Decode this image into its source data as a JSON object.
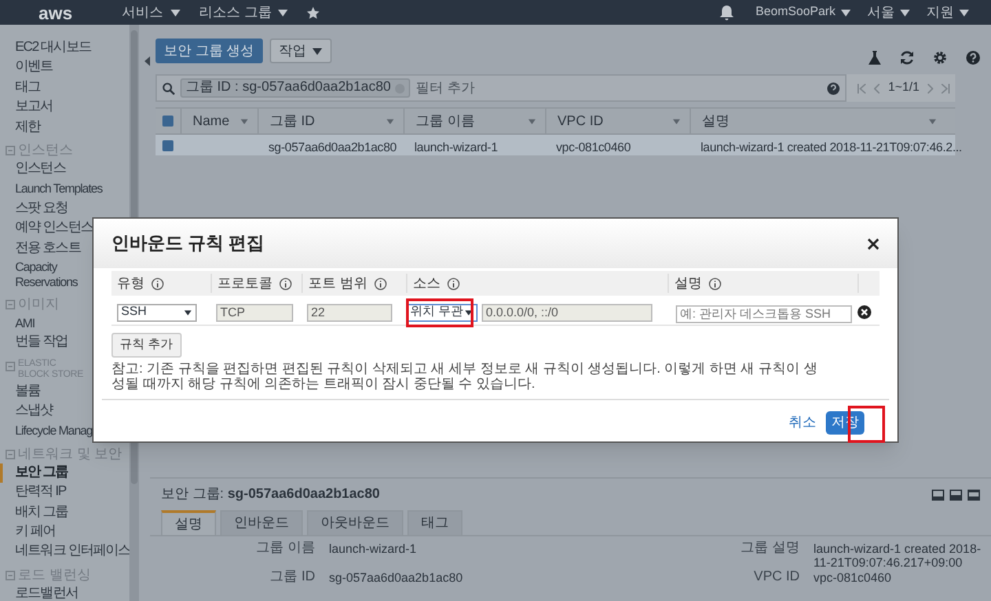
{
  "nav": {
    "logo": "aws",
    "menus": [
      "서비스",
      "리소스 그룹"
    ],
    "user": "BeomSooPark",
    "region": "서울",
    "support": "지원"
  },
  "sidebar": {
    "items": [
      {
        "kind": "item",
        "label": "EC2 대시보드",
        "selected": false
      },
      {
        "kind": "item",
        "label": "이벤트",
        "selected": false
      },
      {
        "kind": "item",
        "label": "태그",
        "selected": false
      },
      {
        "kind": "item",
        "label": "보고서",
        "selected": false
      },
      {
        "kind": "item",
        "label": "제한",
        "selected": false
      },
      {
        "kind": "header",
        "label": "인스턴스"
      },
      {
        "kind": "item",
        "label": "인스턴스",
        "selected": false
      },
      {
        "kind": "item",
        "label": "Launch Templates",
        "selected": false
      },
      {
        "kind": "item",
        "label": "스팟 요청",
        "selected": false
      },
      {
        "kind": "item",
        "label": "예약 인스턴스",
        "selected": false
      },
      {
        "kind": "item",
        "label": "전용 호스트",
        "selected": false
      },
      {
        "kind": "item",
        "label": "Capacity Reservations",
        "selected": false
      },
      {
        "kind": "header",
        "label": "이미지"
      },
      {
        "kind": "item",
        "label": "AMI",
        "selected": false
      },
      {
        "kind": "item",
        "label": "번들 작업",
        "selected": false
      },
      {
        "kind": "header",
        "label": "ELASTIC BLOCK STORE"
      },
      {
        "kind": "item",
        "label": "볼륨",
        "selected": false
      },
      {
        "kind": "item",
        "label": "스냅샷",
        "selected": false
      },
      {
        "kind": "item",
        "label": "Lifecycle Manag",
        "selected": false
      },
      {
        "kind": "header",
        "label": "네트워크 및 보안"
      },
      {
        "kind": "item",
        "label": "보안 그룹",
        "selected": true
      },
      {
        "kind": "item",
        "label": "탄력적 IP",
        "selected": false
      },
      {
        "kind": "item",
        "label": "배치 그룹",
        "selected": false
      },
      {
        "kind": "item",
        "label": "키 페어",
        "selected": false
      },
      {
        "kind": "item",
        "label": "네트워크 인터페이스",
        "selected": false
      },
      {
        "kind": "header",
        "label": "로드 밸런싱"
      },
      {
        "kind": "item",
        "label": "로드밸런서",
        "selected": false
      }
    ]
  },
  "toolbar": {
    "create_button": "보안 그룹 생성",
    "actions_button": "작업"
  },
  "filter": {
    "chip": "그룹 ID : sg-057aa6d0aa2b1ac80",
    "placeholder": "필터 추가",
    "pagination": "1~1/1"
  },
  "table": {
    "all_selected": true,
    "columns": [
      "Name",
      "그룹 ID",
      "그룹 이름",
      "VPC ID",
      "설명"
    ],
    "rows": [
      {
        "selected": true,
        "group_id": "sg-057aa6d0aa2b1ac80",
        "group_name": "launch-wizard-1",
        "vpc_id": "vpc-081c0460",
        "description": "launch-wizard-1 created 2018-11-21T09:07:46.2..."
      }
    ]
  },
  "modal": {
    "title": "인바운드 규칙 편집",
    "columns": [
      "유형",
      "프로토콜",
      "포트 범위",
      "소스",
      "설명"
    ],
    "rule": {
      "type": "SSH",
      "protocol": "TCP",
      "port_range": "22",
      "source": "위치 무관",
      "source_highlighted": true,
      "cidr": "0.0.0.0/0, ::/0",
      "description_placeholder": "예: 관리자 데스크톱용 SSH"
    },
    "add_rule": "규칙 추가",
    "note": "참고: 기존 규칙을 편집하면 편집된 규칙이 삭제되고 새 세부 정보로 새 규칙이 생성됩니다. 이렇게 하면 새 규칙이 생성될 때까지 해당 규칙에 의존하는 트래픽이 잠시 중단될 수 있습니다.",
    "cancel": "취소",
    "save": "저장",
    "save_highlighted": true
  },
  "details": {
    "title": "보안 그룹: **sg-057aa6d0aa2b1ac80**",
    "tabs": [
      {
        "label": "설명",
        "selected": true
      },
      {
        "label": "인바운드",
        "selected": false
      },
      {
        "label": "아웃바운드",
        "selected": false
      },
      {
        "label": "태그",
        "selected": false
      }
    ],
    "fields": [
      {
        "label": "그룹 이름",
        "value": "launch-wizard-1"
      },
      {
        "label": "그룹 설명",
        "value": "launch-wizard-1 created 2018-11-21T09:07:46.217+09:00"
      },
      {
        "label": "그룹 ID",
        "value": "sg-057aa6d0aa2b1ac80"
      },
      {
        "label": "VPC ID",
        "value": "vpc-081c0460"
      }
    ]
  }
}
